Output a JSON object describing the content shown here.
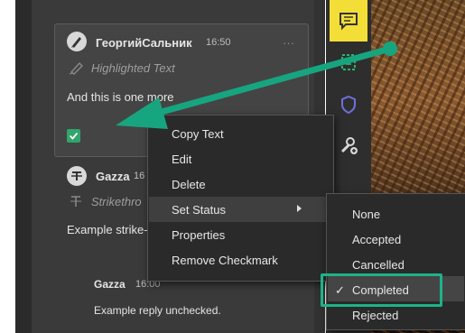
{
  "comments": [
    {
      "author": "ГеоргийСальник",
      "time": "16:50",
      "type_label": "Highlighted Text",
      "body": "And this is one more",
      "more": "···"
    },
    {
      "author": "Gazza",
      "time": "16",
      "type_label": "Strikethro",
      "body": "Example strike-"
    }
  ],
  "reply": {
    "author": "Gazza",
    "time": "16:00",
    "body": "Example reply unchecked."
  },
  "context_menu": {
    "items": [
      "Copy Text",
      "Edit",
      "Delete",
      "Set Status",
      "Properties",
      "Remove Checkmark"
    ],
    "highlighted": "Set Status"
  },
  "status_submenu": {
    "items": [
      "None",
      "Accepted",
      "Cancelled",
      "Completed",
      "Rejected"
    ],
    "checked": "Completed"
  },
  "icons": {
    "toolbar": [
      "comment-icon",
      "compare-icon",
      "shield-icon",
      "tools-icon"
    ]
  },
  "colors": {
    "accent_yellow": "#f2de36",
    "callout_green": "#1db38a",
    "checkbox_green": "#2fa66a"
  }
}
